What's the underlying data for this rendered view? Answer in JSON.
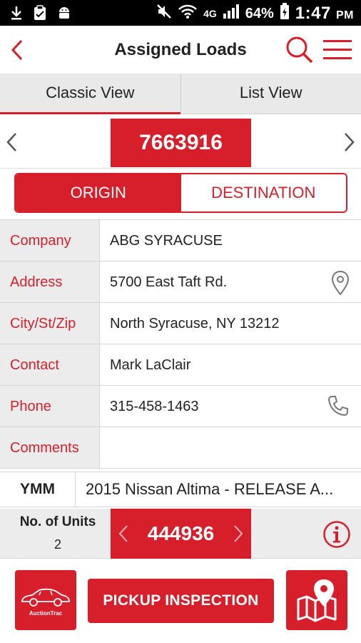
{
  "status_bar": {
    "network": "4G",
    "battery": "64%",
    "time": "1:47",
    "ampm": "PM"
  },
  "header": {
    "title": "Assigned Loads"
  },
  "view_tabs": [
    {
      "label": "Classic View",
      "active": true
    },
    {
      "label": "List View",
      "active": false
    }
  ],
  "load": {
    "number": "7663916"
  },
  "location_toggle": {
    "origin": "ORIGIN",
    "destination": "DESTINATION",
    "selected": "ORIGIN"
  },
  "details": [
    {
      "label": "Company",
      "value": "ABG SYRACUSE",
      "icon": ""
    },
    {
      "label": "Address",
      "value": "5700 East Taft Rd.",
      "icon": "location-pin-icon"
    },
    {
      "label": "City/St/Zip",
      "value": "North Syracuse, NY 13212",
      "icon": ""
    },
    {
      "label": "Contact",
      "value": "Mark LaClair",
      "icon": ""
    },
    {
      "label": "Phone",
      "value": "315-458-1463",
      "icon": "phone-icon"
    },
    {
      "label": "Comments",
      "value": "",
      "icon": ""
    }
  ],
  "ymm": {
    "label": "YMM",
    "value": "2015 Nissan Altima - RELEASE A..."
  },
  "units": {
    "label": "No. of Units",
    "count": "2",
    "unit_number": "444936"
  },
  "actions": {
    "logo_text": "AuctionTrac",
    "pickup_label": "PICKUP INSPECTION"
  },
  "colors": {
    "accent": "#d71f2b",
    "label_bg": "#ececec",
    "status_bar": "#000000"
  }
}
